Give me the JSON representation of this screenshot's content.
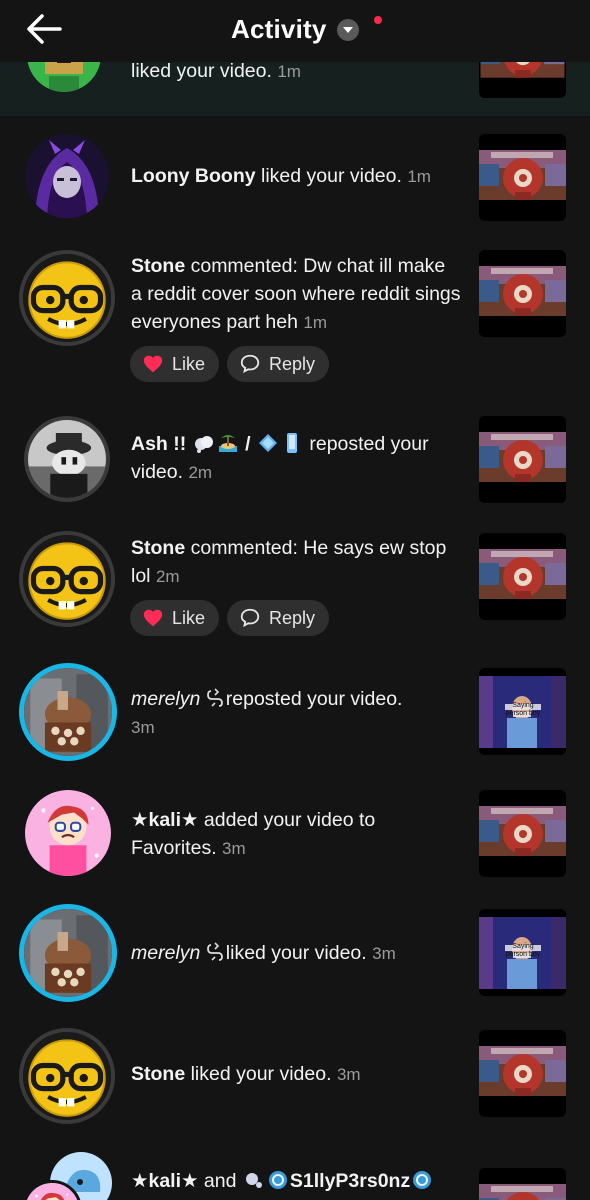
{
  "header": {
    "title": "Activity",
    "back_icon": "arrow-left-icon",
    "dropdown_icon": "chevron-down-icon",
    "indicator_color": "#ff2a4f"
  },
  "actions": {
    "like_label": "Like",
    "reply_label": "Reply"
  },
  "items": [
    {
      "user": "",
      "action": "liked your video.",
      "time": "1m"
    },
    {
      "user": "Loony Boony",
      "action": "liked your video.",
      "time": "1m"
    },
    {
      "user": "Stone",
      "action": "commented: Dw chat ill make a reddit cover soon where reddit sings everyones part heh",
      "time": "1m"
    },
    {
      "user": "Ash !!",
      "user_extra": "/",
      "action": "reposted your video.",
      "time": "2m"
    },
    {
      "user": "Stone",
      "action": "commented: He says ew stop lol",
      "time": "2m"
    },
    {
      "user": "merelyn",
      "action": "reposted your video.",
      "time": "3m"
    },
    {
      "user": "★kali★",
      "action": "added your video to Favorites.",
      "time": "3m"
    },
    {
      "user": "merelyn",
      "action": "liked your video.",
      "time": "3m"
    },
    {
      "user": "Stone",
      "action": "liked your video.",
      "time": "3m"
    },
    {
      "user": "★kali★",
      "conj": "and",
      "user2": "S1llyP3rs0nz"
    }
  ],
  "thumb_caption": "Saying person boy"
}
